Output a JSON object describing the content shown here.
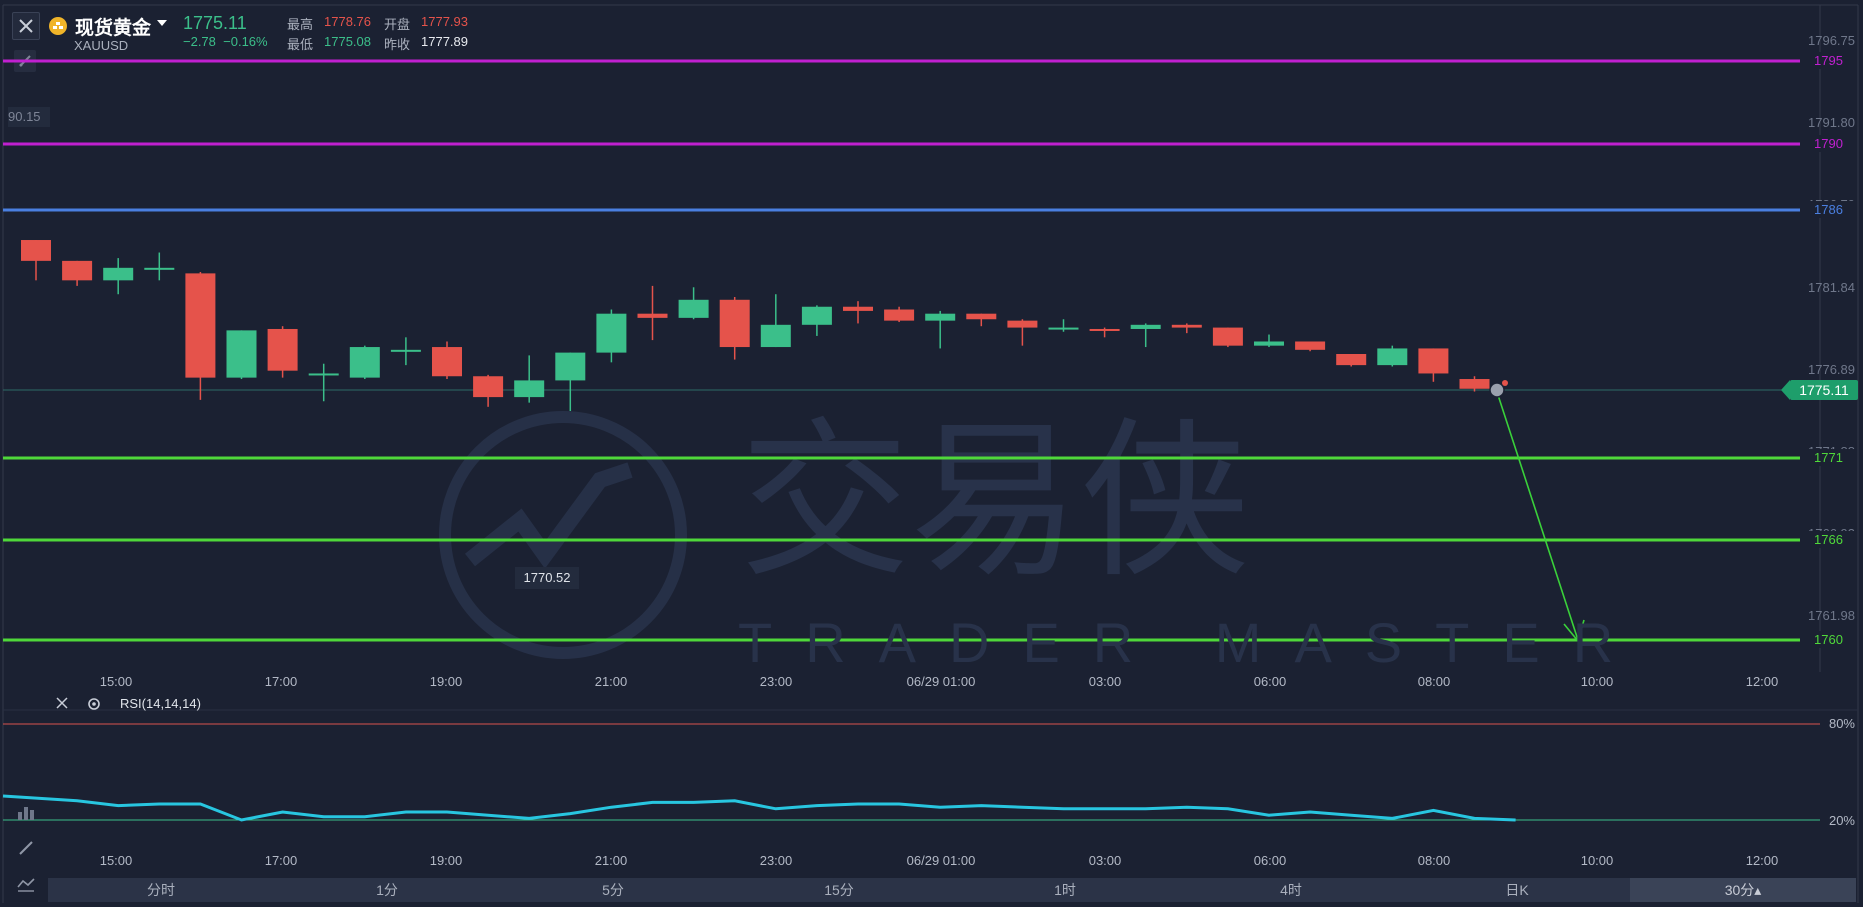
{
  "header": {
    "symbol_name": "现货黄金",
    "symbol_code": "XAUUSD",
    "last_price": "1775.11",
    "change": "−2.78",
    "change_pct": "−0.16%",
    "high_label": "最高",
    "high_value": "1778.76",
    "open_label": "开盘",
    "open_value": "1777.93",
    "low_label": "最低",
    "low_value": "1775.08",
    "prev_close_label": "昨收",
    "prev_close_value": "1777.89"
  },
  "y_axis": {
    "ticks": [
      "1796.75",
      "1791.80",
      "1786.79",
      "1781.84",
      "1776.89",
      "1771.88",
      "1766.93",
      "1761.98"
    ],
    "current_badge": "1775.11"
  },
  "levels": [
    {
      "label": "1795",
      "price": 1795,
      "color": "#c020d0"
    },
    {
      "label": "1790",
      "price": 1790,
      "color": "#c020d0"
    },
    {
      "label": "1786",
      "price": 1786,
      "color": "#4a7fe0"
    },
    {
      "label": "1771",
      "price": 1771,
      "color": "#4fd83a"
    },
    {
      "label": "1766",
      "price": 1766,
      "color": "#4fd83a"
    },
    {
      "label": "1760",
      "price": 1760,
      "color": "#4fd83a"
    }
  ],
  "x_axis": {
    "ticks": [
      "15:00",
      "17:00",
      "19:00",
      "21:00",
      "23:00",
      "06/29 01:00",
      "03:00",
      "06:00",
      "08:00",
      "10:00",
      "12:00"
    ]
  },
  "tooltips": {
    "left_price": "90.15",
    "low_price": "1770.52"
  },
  "watermark": {
    "cn": "交易侠",
    "en": "TRADER MASTER"
  },
  "candles": [
    {
      "o": 1785.9,
      "c": 1784.4,
      "h": 1785.9,
      "l": 1783.0
    },
    {
      "o": 1784.4,
      "c": 1783.0,
      "h": 1784.4,
      "l": 1782.6
    },
    {
      "o": 1783.0,
      "c": 1783.9,
      "h": 1784.6,
      "l": 1782.0
    },
    {
      "o": 1783.9,
      "c": 1783.9,
      "h": 1785.0,
      "l": 1783.0
    },
    {
      "o": 1783.5,
      "c": 1776.0,
      "h": 1783.6,
      "l": 1774.4
    },
    {
      "o": 1776.0,
      "c": 1779.4,
      "h": 1779.4,
      "l": 1775.9
    },
    {
      "o": 1779.5,
      "c": 1776.5,
      "h": 1779.7,
      "l": 1776.0
    },
    {
      "o": 1776.3,
      "c": 1776.3,
      "h": 1777.0,
      "l": 1774.3
    },
    {
      "o": 1776.0,
      "c": 1778.2,
      "h": 1778.3,
      "l": 1775.9
    },
    {
      "o": 1778.0,
      "c": 1778.0,
      "h": 1778.9,
      "l": 1776.9
    },
    {
      "o": 1778.2,
      "c": 1776.1,
      "h": 1778.6,
      "l": 1775.9
    },
    {
      "o": 1776.1,
      "c": 1774.6,
      "h": 1776.2,
      "l": 1773.9
    },
    {
      "o": 1774.6,
      "c": 1775.8,
      "h": 1777.6,
      "l": 1774.2
    },
    {
      "o": 1775.8,
      "c": 1777.8,
      "h": 1777.8,
      "l": 1773.6
    },
    {
      "o": 1777.8,
      "c": 1780.6,
      "h": 1780.9,
      "l": 1777.1
    },
    {
      "o": 1780.6,
      "c": 1780.3,
      "h": 1782.6,
      "l": 1778.7
    },
    {
      "o": 1780.3,
      "c": 1781.6,
      "h": 1782.5,
      "l": 1780.2
    },
    {
      "o": 1781.6,
      "c": 1778.2,
      "h": 1781.8,
      "l": 1777.3
    },
    {
      "o": 1778.2,
      "c": 1779.8,
      "h": 1782.0,
      "l": 1778.2
    },
    {
      "o": 1779.8,
      "c": 1781.1,
      "h": 1781.2,
      "l": 1779.0
    },
    {
      "o": 1781.1,
      "c": 1780.8,
      "h": 1781.5,
      "l": 1779.9
    },
    {
      "o": 1780.9,
      "c": 1780.1,
      "h": 1781.1,
      "l": 1780.0
    },
    {
      "o": 1780.1,
      "c": 1780.6,
      "h": 1780.8,
      "l": 1778.1
    },
    {
      "o": 1780.6,
      "c": 1780.2,
      "h": 1780.6,
      "l": 1779.7
    },
    {
      "o": 1780.1,
      "c": 1779.6,
      "h": 1780.2,
      "l": 1778.3
    },
    {
      "o": 1779.6,
      "c": 1779.6,
      "h": 1780.2,
      "l": 1779.3
    },
    {
      "o": 1779.5,
      "c": 1779.4,
      "h": 1779.6,
      "l": 1778.9
    },
    {
      "o": 1779.5,
      "c": 1779.8,
      "h": 1779.9,
      "l": 1778.2
    },
    {
      "o": 1779.8,
      "c": 1779.6,
      "h": 1779.9,
      "l": 1779.2
    },
    {
      "o": 1779.6,
      "c": 1778.3,
      "h": 1779.6,
      "l": 1778.2
    },
    {
      "o": 1778.3,
      "c": 1778.6,
      "h": 1779.1,
      "l": 1778.2
    },
    {
      "o": 1778.6,
      "c": 1778.0,
      "h": 1778.6,
      "l": 1777.9
    },
    {
      "o": 1777.7,
      "c": 1776.9,
      "h": 1777.7,
      "l": 1776.8
    },
    {
      "o": 1776.9,
      "c": 1778.1,
      "h": 1778.3,
      "l": 1776.8
    },
    {
      "o": 1778.1,
      "c": 1776.3,
      "h": 1778.1,
      "l": 1775.7
    },
    {
      "o": 1775.9,
      "c": 1775.2,
      "h": 1776.1,
      "l": 1775.0
    }
  ],
  "rsi": {
    "label": "RSI(14,14,14)",
    "levels": [
      "80%",
      "20%"
    ],
    "values": [
      35,
      32,
      29,
      30,
      30,
      20,
      25,
      22,
      22,
      25,
      25,
      23,
      21,
      24,
      28,
      31,
      31,
      32,
      27,
      29,
      30,
      30,
      28,
      29,
      28,
      27,
      27,
      27,
      28,
      27,
      23,
      25,
      23,
      21,
      26,
      21,
      20
    ]
  },
  "timeframes": [
    {
      "label": "分时",
      "active": false
    },
    {
      "label": "1分",
      "active": false
    },
    {
      "label": "5分",
      "active": false
    },
    {
      "label": "15分",
      "active": false
    },
    {
      "label": "1时",
      "active": false
    },
    {
      "label": "4时",
      "active": false
    },
    {
      "label": "日K",
      "active": false
    },
    {
      "label": "30分▴",
      "active": true
    }
  ],
  "colors": {
    "up": "#3bbf8a",
    "down": "#e5534b",
    "rsi": "#28c6e0",
    "arrow": "#3ad13a"
  }
}
